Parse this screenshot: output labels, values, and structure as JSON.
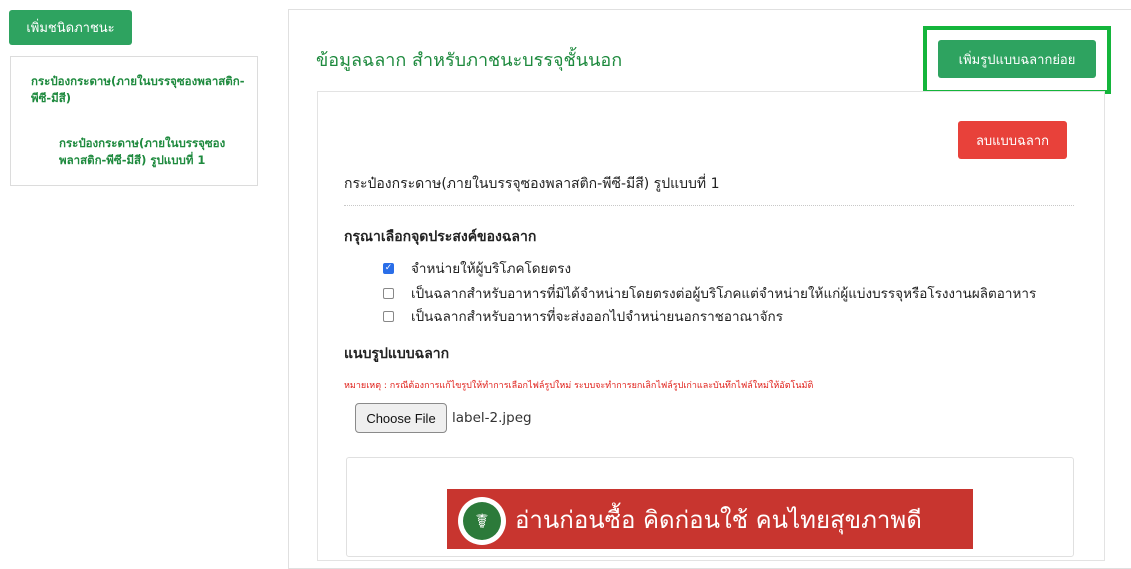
{
  "sidebar": {
    "add_button_label": "เพิ่มชนิดภาชนะ",
    "tree": {
      "parent_label": "กระป๋องกระดาษ(ภายในบรรจุซองพลาสติก-พีซี-มีสี)",
      "child_label": "กระป๋องกระดาษ(ภายในบรรจุซองพลาสติก-พีซี-มีสี) รูปแบบที่ 1"
    }
  },
  "main": {
    "title": "ข้อมูลฉลาก สำหรับภาชนะบรรจุชั้นนอก",
    "add_subform_label": "เพิ่มรูปแบบฉลากย่อย",
    "delete_label": "ลบแบบฉลาก",
    "form_heading": "กระป๋องกระดาษ(ภายในบรรจุซองพลาสติก-พีซี-มีสี)  รูปแบบที่ 1",
    "purpose_label": "กรุณาเลือกจุดประสงค์ของฉลาก",
    "purpose_options": [
      {
        "label": "จำหน่ายให้ผู้บริโภคโดยตรง",
        "checked": true
      },
      {
        "label": "เป็นฉลากสำหรับอาหารที่มิได้จำหน่ายโดยตรงต่อผู้บริโภคแต่จำหน่ายให้แก่ผู้แบ่งบรรจุหรือโรงงานผลิตอาหาร",
        "checked": false
      },
      {
        "label": "เป็นฉลากสำหรับอาหารที่จะส่งออกไปจำหน่ายนอกราชอาณาจักร",
        "checked": false
      }
    ],
    "attach_label": "แนบรูปแบบฉลาก",
    "note": "หมายเหตุ : กรณีต้องการแก้ไขรูปให้ทำการเลือกไฟล์รูปใหม่ ระบบจะทำการยกเลิกไฟล์รูปเก่าและบันทึกไฟล์ใหม่ให้อัตโนมัติ",
    "choose_file_label": "Choose File",
    "file_name": "label-2.jpeg",
    "label_image_text": "อ่านก่อนซื้อ  คิดก่อนใช้  คนไทยสุขภาพดี"
  },
  "colors": {
    "primary_green": "#2ea360",
    "highlight_green": "#14b53b",
    "danger_red": "#e8413a",
    "title_green": "#1e8a3e"
  }
}
